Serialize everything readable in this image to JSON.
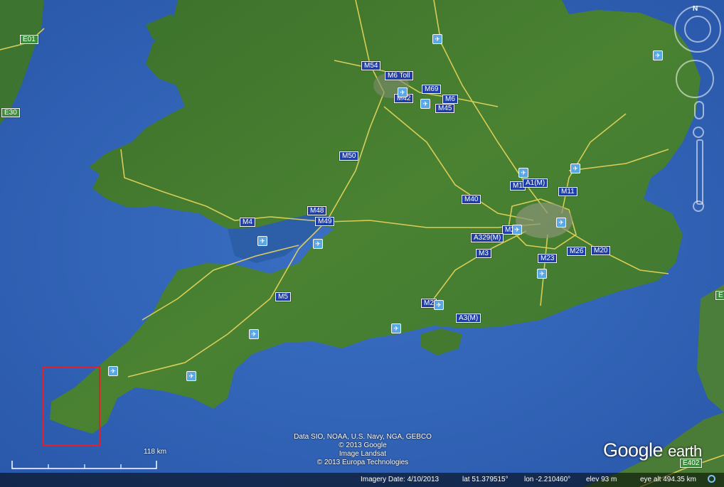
{
  "road_labels": [
    {
      "id": "m54",
      "text": "M54",
      "eroad": false
    },
    {
      "id": "m6toll",
      "text": "M6 Toll",
      "eroad": false
    },
    {
      "id": "m69",
      "text": "M69",
      "eroad": false
    },
    {
      "id": "m42",
      "text": "M42",
      "eroad": false
    },
    {
      "id": "m6",
      "text": "M6",
      "eroad": false
    },
    {
      "id": "m45",
      "text": "M45",
      "eroad": false
    },
    {
      "id": "m50",
      "text": "M50",
      "eroad": false
    },
    {
      "id": "m1",
      "text": "M1",
      "eroad": false
    },
    {
      "id": "a1m",
      "text": "A1(M)",
      "eroad": false
    },
    {
      "id": "m11",
      "text": "M11",
      "eroad": false
    },
    {
      "id": "m40",
      "text": "M40",
      "eroad": false
    },
    {
      "id": "m48",
      "text": "M48",
      "eroad": false
    },
    {
      "id": "m49",
      "text": "M49",
      "eroad": false
    },
    {
      "id": "m4",
      "text": "M4",
      "eroad": false
    },
    {
      "id": "m25",
      "text": "M2",
      "eroad": false
    },
    {
      "id": "a329m",
      "text": "A329(M)",
      "eroad": false
    },
    {
      "id": "m3",
      "text": "M3",
      "eroad": false
    },
    {
      "id": "m26",
      "text": "M26",
      "eroad": false
    },
    {
      "id": "m20",
      "text": "M20",
      "eroad": false
    },
    {
      "id": "m23",
      "text": "M23",
      "eroad": false
    },
    {
      "id": "m5",
      "text": "M5",
      "eroad": false
    },
    {
      "id": "m27",
      "text": "M2",
      "eroad": false
    },
    {
      "id": "a3m",
      "text": "A3(M)",
      "eroad": false
    },
    {
      "id": "e01",
      "text": "E01",
      "eroad": true
    },
    {
      "id": "e30",
      "text": "E30",
      "eroad": true
    },
    {
      "id": "e402",
      "text": "E402",
      "eroad": true
    },
    {
      "id": "e4",
      "text": "E",
      "eroad": true
    }
  ],
  "airport_icon": "airport-icon",
  "attribution": {
    "line1": "Data SIO, NOAA, U.S. Navy, NGA, GEBCO",
    "line2": "© 2013 Google",
    "line3": "Image Landsat",
    "line4": "© 2013 Europa Technologies"
  },
  "scale": {
    "label": "118 km"
  },
  "logo": {
    "google": "Google",
    "earth": "earth"
  },
  "status": {
    "imagery_date": "Imagery Date: 4/10/2013",
    "lat": "lat   51.379515°",
    "lon": "lon   -2.210460°",
    "elev": "elev     93 m",
    "eye_alt": "eye alt 494.35 km"
  },
  "nav": {
    "north": "N"
  },
  "colors": {
    "sea": "#2f63b8",
    "land": "#3f7a2e",
    "road": "#e8d65a",
    "highlight": "#e0202a"
  }
}
